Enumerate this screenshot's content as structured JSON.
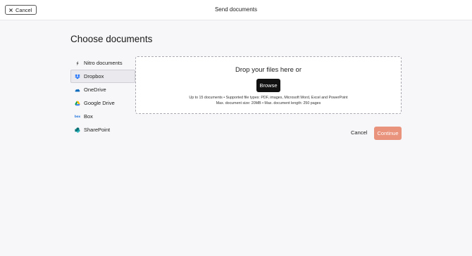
{
  "header": {
    "cancel_label": "Cancel",
    "title": "Send documents"
  },
  "main": {
    "heading": "Choose documents",
    "sources": [
      {
        "label": "Nitro documents",
        "icon": "nitro-icon",
        "selected": false
      },
      {
        "label": "Dropbox",
        "icon": "dropbox-icon",
        "selected": true
      },
      {
        "label": "OneDrive",
        "icon": "onedrive-icon",
        "selected": false
      },
      {
        "label": "Google Drive",
        "icon": "google-drive-icon",
        "selected": false
      },
      {
        "label": "Box",
        "icon": "box-icon",
        "icon_text": "box",
        "selected": false
      },
      {
        "label": "SharePoint",
        "icon": "sharepoint-icon",
        "selected": false
      }
    ],
    "dropzone": {
      "prompt": "Drop your files here or",
      "browse_label": "Browse",
      "info_line1": "Up to 15 documents • Supported file types: PDF, images, Microsoft Word, Excel and PowerPoint",
      "info_line2": "Max. document size: 20MB • Max. document length: 250 pages"
    },
    "actions": {
      "cancel_label": "Cancel",
      "continue_label": "Continue"
    }
  },
  "colors": {
    "continue_button": "#e9927c",
    "browse_button": "#111111",
    "dropbox": "#0061fe",
    "onedrive": "#0f6cbd",
    "sharepoint": "#03787c"
  }
}
